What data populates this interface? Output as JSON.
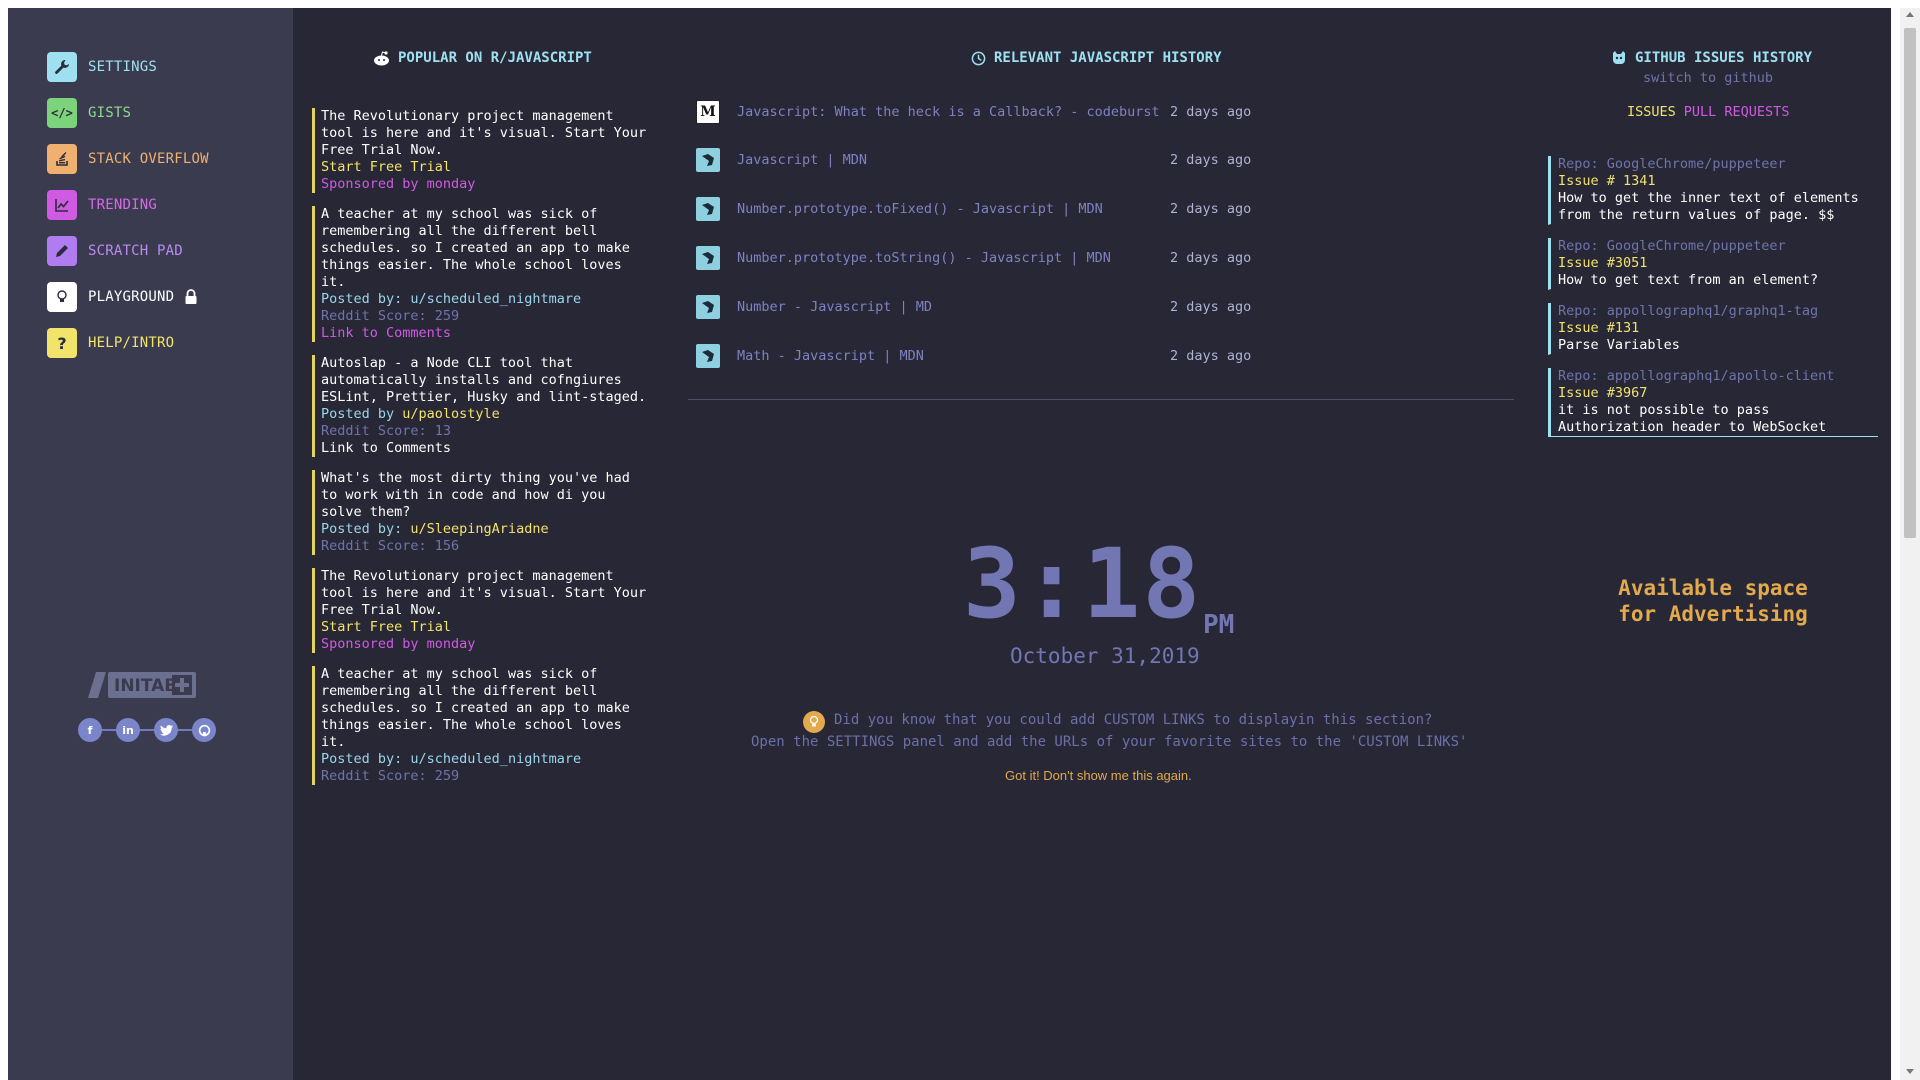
{
  "sidebar": {
    "items": [
      {
        "label": "SETTINGS",
        "icon": "wrench-icon",
        "color": "#9fe0f0",
        "icon_bg": "#9fe0f0"
      },
      {
        "label": "GISTS",
        "icon": "code-icon",
        "color": "#8ddc8c",
        "icon_bg": "#7dd37c"
      },
      {
        "label": "STACK OVERFLOW",
        "icon": "stack-overflow-icon",
        "color": "#f0b070",
        "icon_bg": "#f0b070"
      },
      {
        "label": "TRENDING",
        "icon": "chart-icon",
        "color": "#d76ae8",
        "icon_bg": "#d15ae3"
      },
      {
        "label": "SCRATCH PAD",
        "icon": "pencil-icon",
        "color": "#b98cf0",
        "icon_bg": "#b07cf0"
      },
      {
        "label": "PLAYGROUND",
        "icon": "lightbulb-icon",
        "color": "#ffffff",
        "icon_bg": "#ffffff"
      },
      {
        "label": "HELP/INTRO",
        "icon": "question-icon",
        "color": "#f2e36b",
        "icon_bg": "#f2e36b"
      }
    ],
    "logo_text": "INITAB",
    "social": [
      "facebook-icon",
      "linkedin-icon",
      "twitter-icon",
      "github-icon"
    ]
  },
  "reddit": {
    "heading": "POPULAR ON R/JAVASCRIPT",
    "posts": [
      {
        "text": "The Revolutionary project management tool is here and it's visual. Start Your Free Trial Now.",
        "line1": "Start Free Trial",
        "line2": "Sponsored by monday"
      },
      {
        "text": "A teacher at my school was sick of remembering all the different bell schedules. so I created an app to make things easier. The whole school loves it.",
        "line1_prefix": "Posted by: ",
        "user": "u/scheduled_nightmare",
        "score": "Reddit Score: 259",
        "comments": "Link to Comments"
      },
      {
        "text": "Autoslap - a Node CLI tool that automatically installs and cofngiures ESLint, Prettier, Husky and lint-staged.",
        "line1_prefix": "Posted by ",
        "user": "u/paolostyle",
        "score": "Reddit Score: 13",
        "comments": "Link to Comments"
      },
      {
        "text": "What's the most dirty thing you've had to work with in code and how di you solve them?",
        "line1_prefix": "Posted by: ",
        "user": "u/SleepingAriadne",
        "score": "Reddit Score: 156"
      },
      {
        "text": "The Revolutionary project management tool is here and it's visual. Start Your Free Trial Now.",
        "line1": "Start Free Trial",
        "line2": "Sponsored by monday"
      },
      {
        "text": "A teacher at my school was sick of remembering all the different bell schedules. so I created an app to make things easier. The whole school loves it.",
        "line1_prefix": "Posted by: ",
        "user": "u/scheduled_nightmare",
        "score": "Reddit Score: 259"
      }
    ]
  },
  "history": {
    "heading": "RELEVANT JAVASCRIPT HISTORY",
    "items": [
      {
        "title": "Javascript: What the heck is a Callback? - codeburst",
        "date": "2 days ago",
        "icon": "medium-icon"
      },
      {
        "title": "Javascript | MDN",
        "date": "2 days ago",
        "icon": "mdn-icon"
      },
      {
        "title": "Number.prototype.toFixed() - Javascript | MDN",
        "date": "2 days ago",
        "icon": "mdn-icon"
      },
      {
        "title": "Number.prototype.toString() - Javascript | MDN",
        "date": "2 days ago",
        "icon": "mdn-icon"
      },
      {
        "title": "Number - Javascript | MD",
        "date": "2 days ago",
        "icon": "mdn-icon"
      },
      {
        "title": "Math - Javascript | MDN",
        "date": "2 days ago",
        "icon": "mdn-icon"
      }
    ]
  },
  "clock": {
    "time": "3:18",
    "ampm": "PM",
    "date": "October 31,2019"
  },
  "tip": {
    "line1": "Did you know that you could add CUSTOM LINKS to displayin this section?",
    "line2": "Open the SETTINGS panel and add the URLs of your favorite sites to the 'CUSTOM LINKS'",
    "dismiss": "Got it! Don't show me this again."
  },
  "github": {
    "heading": "GITHUB ISSUES HISTORY",
    "switch": "switch to github",
    "tab_issues": "ISSUES",
    "tab_pulls": "PULL REQUESTS",
    "issues": [
      {
        "repo": "Repo: GoogleChrome/puppeteer",
        "number": "Issue # 1341",
        "text": "How to get the inner text of elements from the return values of page. $$"
      },
      {
        "repo": "Repo: GoogleChrome/puppeteer",
        "number": "Issue #3051",
        "text": "How to get text from an element?"
      },
      {
        "repo": "Repo: appollographq1/graphq1-tag",
        "number": "Issue #131",
        "text": "Parse Variables"
      },
      {
        "repo": "Repo: appollographq1/apollo-client",
        "number": "Issue #3967",
        "text": "it is not possible to pass Authorization header to WebSocket"
      }
    ]
  },
  "ad": {
    "text": "Available space for Advertising"
  },
  "colors": {
    "background": "#272736",
    "sidebar": "#3a3b4f",
    "accent_cyan": "#9fe0f0",
    "accent_yellow": "#f2e36b",
    "accent_orange": "#e2a94d",
    "muted": "#6f74a9"
  }
}
